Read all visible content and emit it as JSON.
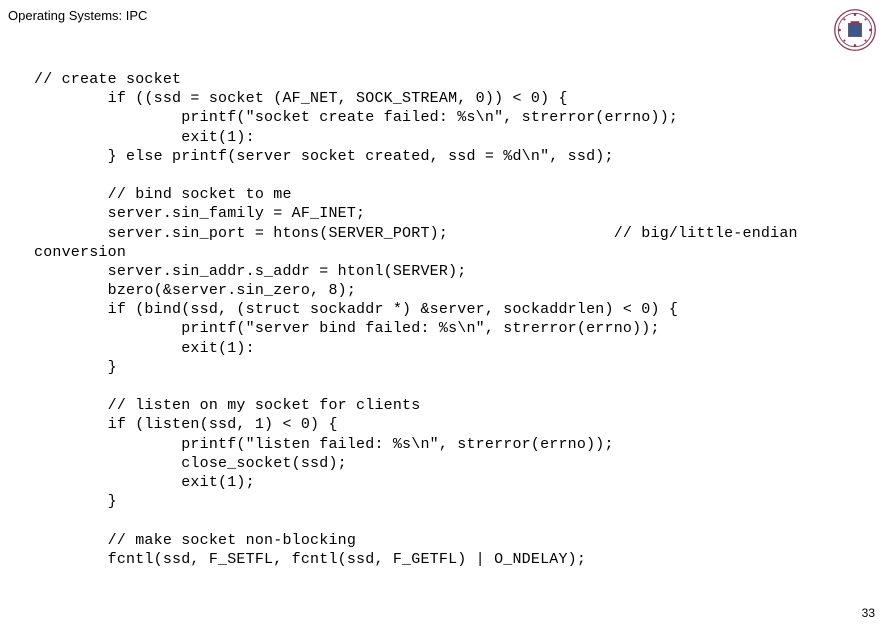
{
  "header": {
    "title": "Operating Systems: IPC"
  },
  "code": {
    "c01": "// create socket",
    "l01": "        if ((ssd = socket (AF_NET, SOCK_STREAM, 0)) < 0) {",
    "l02": "                printf(\"socket create failed: %s\\n\", strerror(errno));",
    "l03": "                exit(1):",
    "l04": "        } else printf(server socket created, ssd = %d\\n\", ssd);",
    "b1": " ",
    "c02": "        // bind socket to me",
    "l05": "        server.sin_family = AF_INET;",
    "l06": "        server.sin_port = htons(SERVER_PORT);                  // big/little-endian",
    "l06b": "conversion",
    "l07": "        server.sin_addr.s_addr = htonl(SERVER);",
    "l08": "        bzero(&server.sin_zero, 8);",
    "l09": "        if (bind(ssd, (struct sockaddr *) &server, sockaddrlen) < 0) {",
    "l10": "                printf(\"server bind failed: %s\\n\", strerror(errno));",
    "l11": "                exit(1):",
    "l12": "        }",
    "b2": " ",
    "c03": "        // listen on my socket for clients",
    "l13": "        if (listen(ssd, 1) < 0) {",
    "l14": "                printf(\"listen failed: %s\\n\", strerror(errno));",
    "l15": "                close_socket(ssd);",
    "l16": "                exit(1);",
    "l17": "        }",
    "b3": " ",
    "c04": "        // make socket non-blocking",
    "l18": "        fcntl(ssd, F_SETFL, fcntl(ssd, F_GETFL) | O_NDELAY);"
  },
  "page_number": "33"
}
